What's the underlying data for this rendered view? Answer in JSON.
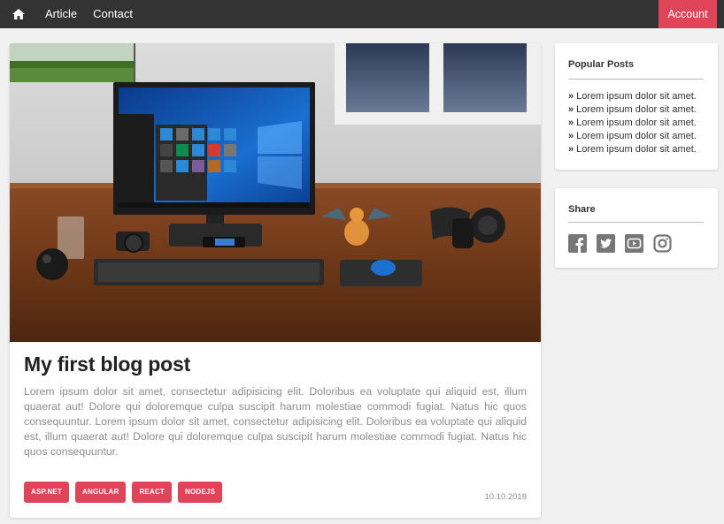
{
  "nav": {
    "home_icon": "home-icon",
    "links": [
      "Article",
      "Contact"
    ],
    "account_label": "Account",
    "background": "#333333",
    "accent": "#e04458"
  },
  "post": {
    "image": "desk-setup-photo",
    "title": "My first blog post",
    "body": "Lorem ipsum dolor sit amet, consectetur adipisicing elit. Doloribus ea voluptate qui aliquid est, illum quaerat aut! Dolore qui doloremque culpa suscipit harum molestiae commodi fugiat. Natus hic quos consequuntur. Lorem ipsum dolor sit amet, consectetur adipisicing elit. Doloribus ea voluptate qui aliquid est, illum quaerat aut! Dolore qui doloremque culpa suscipit harum molestiae commodi fugiat. Natus hic quos consequuntur.",
    "tags": [
      "ASP.NET",
      "ANGULAR",
      "REACT",
      "NODEJS"
    ],
    "date": "10.10.2018"
  },
  "sidebar": {
    "popular": {
      "title": "Popular Posts",
      "items": [
        "Lorem ipsum dolor sit amet.",
        "Lorem ipsum dolor sit amet.",
        "Lorem ipsum dolor sit amet.",
        "Lorem ipsum dolor sit amet.",
        "Lorem ipsum dolor sit amet."
      ]
    },
    "share": {
      "title": "Share",
      "icons": [
        "facebook-icon",
        "twitter-icon",
        "youtube-icon",
        "instagram-icon"
      ]
    }
  }
}
